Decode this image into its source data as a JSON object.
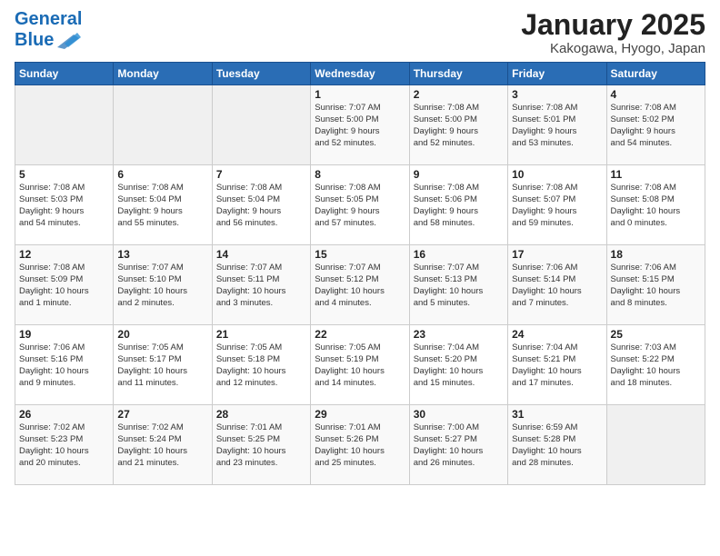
{
  "header": {
    "logo_line1": "General",
    "logo_line2": "Blue",
    "title": "January 2025",
    "subtitle": "Kakogawa, Hyogo, Japan"
  },
  "days_of_week": [
    "Sunday",
    "Monday",
    "Tuesday",
    "Wednesday",
    "Thursday",
    "Friday",
    "Saturday"
  ],
  "weeks": [
    [
      {
        "num": "",
        "info": ""
      },
      {
        "num": "",
        "info": ""
      },
      {
        "num": "",
        "info": ""
      },
      {
        "num": "1",
        "info": "Sunrise: 7:07 AM\nSunset: 5:00 PM\nDaylight: 9 hours\nand 52 minutes."
      },
      {
        "num": "2",
        "info": "Sunrise: 7:08 AM\nSunset: 5:00 PM\nDaylight: 9 hours\nand 52 minutes."
      },
      {
        "num": "3",
        "info": "Sunrise: 7:08 AM\nSunset: 5:01 PM\nDaylight: 9 hours\nand 53 minutes."
      },
      {
        "num": "4",
        "info": "Sunrise: 7:08 AM\nSunset: 5:02 PM\nDaylight: 9 hours\nand 54 minutes."
      }
    ],
    [
      {
        "num": "5",
        "info": "Sunrise: 7:08 AM\nSunset: 5:03 PM\nDaylight: 9 hours\nand 54 minutes."
      },
      {
        "num": "6",
        "info": "Sunrise: 7:08 AM\nSunset: 5:04 PM\nDaylight: 9 hours\nand 55 minutes."
      },
      {
        "num": "7",
        "info": "Sunrise: 7:08 AM\nSunset: 5:04 PM\nDaylight: 9 hours\nand 56 minutes."
      },
      {
        "num": "8",
        "info": "Sunrise: 7:08 AM\nSunset: 5:05 PM\nDaylight: 9 hours\nand 57 minutes."
      },
      {
        "num": "9",
        "info": "Sunrise: 7:08 AM\nSunset: 5:06 PM\nDaylight: 9 hours\nand 58 minutes."
      },
      {
        "num": "10",
        "info": "Sunrise: 7:08 AM\nSunset: 5:07 PM\nDaylight: 9 hours\nand 59 minutes."
      },
      {
        "num": "11",
        "info": "Sunrise: 7:08 AM\nSunset: 5:08 PM\nDaylight: 10 hours\nand 0 minutes."
      }
    ],
    [
      {
        "num": "12",
        "info": "Sunrise: 7:08 AM\nSunset: 5:09 PM\nDaylight: 10 hours\nand 1 minute."
      },
      {
        "num": "13",
        "info": "Sunrise: 7:07 AM\nSunset: 5:10 PM\nDaylight: 10 hours\nand 2 minutes."
      },
      {
        "num": "14",
        "info": "Sunrise: 7:07 AM\nSunset: 5:11 PM\nDaylight: 10 hours\nand 3 minutes."
      },
      {
        "num": "15",
        "info": "Sunrise: 7:07 AM\nSunset: 5:12 PM\nDaylight: 10 hours\nand 4 minutes."
      },
      {
        "num": "16",
        "info": "Sunrise: 7:07 AM\nSunset: 5:13 PM\nDaylight: 10 hours\nand 5 minutes."
      },
      {
        "num": "17",
        "info": "Sunrise: 7:06 AM\nSunset: 5:14 PM\nDaylight: 10 hours\nand 7 minutes."
      },
      {
        "num": "18",
        "info": "Sunrise: 7:06 AM\nSunset: 5:15 PM\nDaylight: 10 hours\nand 8 minutes."
      }
    ],
    [
      {
        "num": "19",
        "info": "Sunrise: 7:06 AM\nSunset: 5:16 PM\nDaylight: 10 hours\nand 9 minutes."
      },
      {
        "num": "20",
        "info": "Sunrise: 7:05 AM\nSunset: 5:17 PM\nDaylight: 10 hours\nand 11 minutes."
      },
      {
        "num": "21",
        "info": "Sunrise: 7:05 AM\nSunset: 5:18 PM\nDaylight: 10 hours\nand 12 minutes."
      },
      {
        "num": "22",
        "info": "Sunrise: 7:05 AM\nSunset: 5:19 PM\nDaylight: 10 hours\nand 14 minutes."
      },
      {
        "num": "23",
        "info": "Sunrise: 7:04 AM\nSunset: 5:20 PM\nDaylight: 10 hours\nand 15 minutes."
      },
      {
        "num": "24",
        "info": "Sunrise: 7:04 AM\nSunset: 5:21 PM\nDaylight: 10 hours\nand 17 minutes."
      },
      {
        "num": "25",
        "info": "Sunrise: 7:03 AM\nSunset: 5:22 PM\nDaylight: 10 hours\nand 18 minutes."
      }
    ],
    [
      {
        "num": "26",
        "info": "Sunrise: 7:02 AM\nSunset: 5:23 PM\nDaylight: 10 hours\nand 20 minutes."
      },
      {
        "num": "27",
        "info": "Sunrise: 7:02 AM\nSunset: 5:24 PM\nDaylight: 10 hours\nand 21 minutes."
      },
      {
        "num": "28",
        "info": "Sunrise: 7:01 AM\nSunset: 5:25 PM\nDaylight: 10 hours\nand 23 minutes."
      },
      {
        "num": "29",
        "info": "Sunrise: 7:01 AM\nSunset: 5:26 PM\nDaylight: 10 hours\nand 25 minutes."
      },
      {
        "num": "30",
        "info": "Sunrise: 7:00 AM\nSunset: 5:27 PM\nDaylight: 10 hours\nand 26 minutes."
      },
      {
        "num": "31",
        "info": "Sunrise: 6:59 AM\nSunset: 5:28 PM\nDaylight: 10 hours\nand 28 minutes."
      },
      {
        "num": "",
        "info": ""
      }
    ]
  ]
}
